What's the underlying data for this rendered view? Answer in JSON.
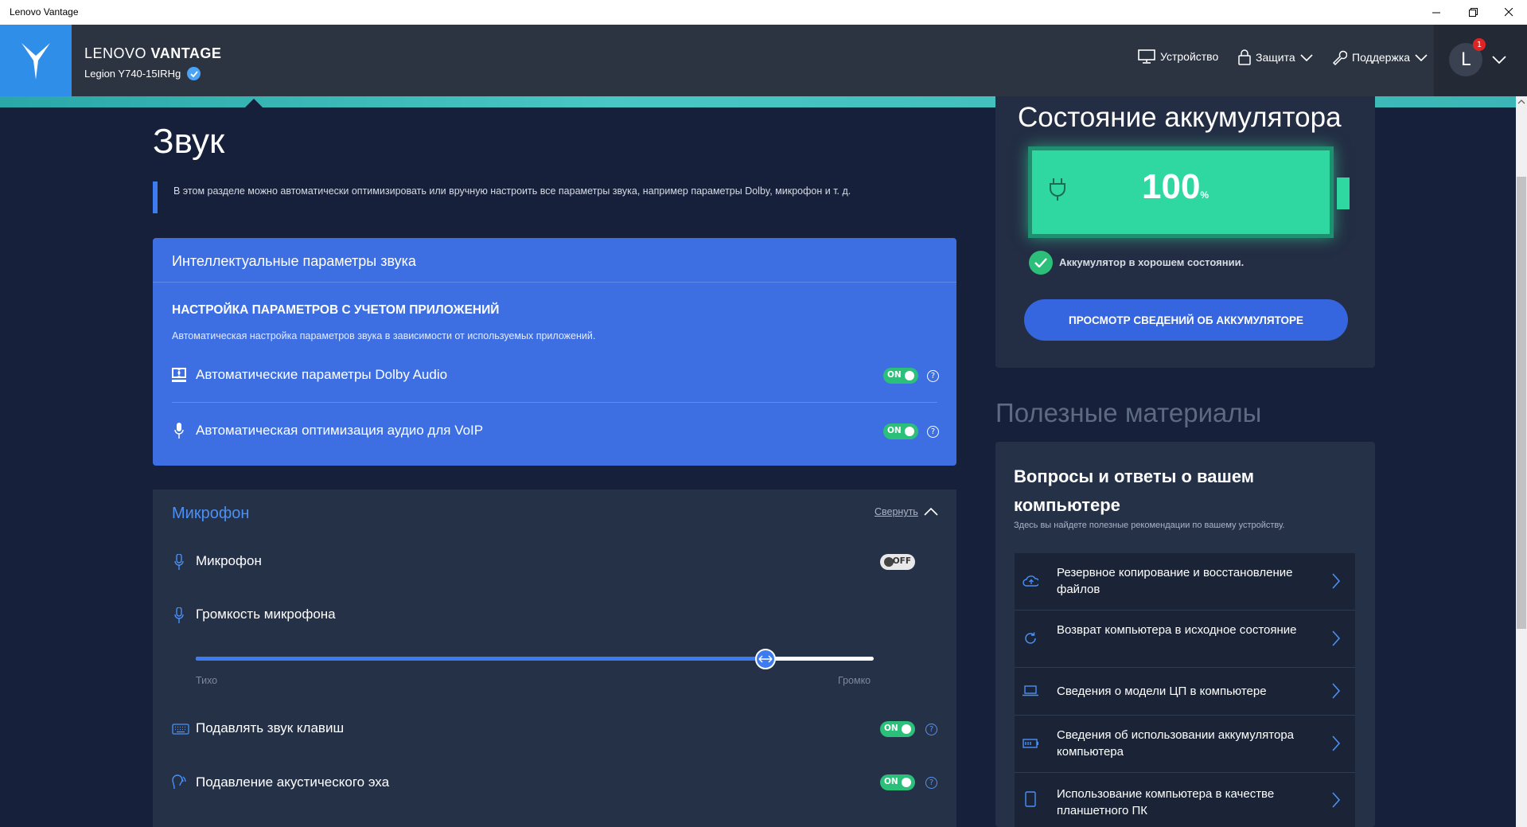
{
  "window": {
    "title": "Lenovo Vantage"
  },
  "header": {
    "brand_light": "LENOVO ",
    "brand_bold": "VANTAGE",
    "model": "Legion Y740-15IRHg",
    "nav": {
      "device": "Устройство",
      "security": "Защита",
      "support": "Поддержка"
    },
    "user_initial": "L",
    "notification_count": "1"
  },
  "page": {
    "title": "Звук",
    "description": "В этом разделе можно автоматически оптимизировать или вручную настроить все параметры звука, например параметры Dolby, микрофон и т. д."
  },
  "smart_audio": {
    "title": "Интеллектуальные параметры звука",
    "subtitle": "НАСТРОЙКА ПАРАМЕТРОВ С УЧЕТОМ ПРИЛОЖЕНИЙ",
    "description": "Автоматическая настройка параметров звука в зависимости от используемых приложений.",
    "rows": [
      {
        "label": "Автоматические параметры Dolby Audio",
        "state": "ON",
        "icon": "dolby-icon"
      },
      {
        "label": "Автоматическая оптимизация аудио для VoIP",
        "state": "ON",
        "icon": "voip-microphone-icon"
      }
    ]
  },
  "microphone": {
    "title": "Микрофон",
    "collapse_label": "Свернуть",
    "mic_label": "Микрофон",
    "mic_state": "OFF",
    "volume_label": "Громкость микрофона",
    "volume_low": "Тихо",
    "volume_high": "Громко",
    "volume_level": 0.84,
    "keyboard_noise_label": "Подавлять звук клавиш",
    "keyboard_noise_state": "ON",
    "echo_label": "Подавление акустического эха",
    "echo_state": "ON"
  },
  "battery": {
    "title": "Состояние аккумулятора",
    "percent": "100",
    "percent_unit": "%",
    "status": "Аккумулятор в хорошем состоянии.",
    "button": "ПРОСМОТР СВЕДЕНИЙ ОБ АККУМУЛЯТОРЕ"
  },
  "useful": {
    "title": "Полезные материалы"
  },
  "faq": {
    "title": "Вопросы и ответы о вашем компьютере",
    "subtitle": "Здесь вы найдете полезные рекомендации по вашему устройству.",
    "items": [
      {
        "label": "Резервное копирование и восстановление файлов",
        "icon": "cloud-backup-icon"
      },
      {
        "label": "Возврат компьютера в исходное состояние",
        "icon": "refresh-icon"
      },
      {
        "label": "Сведения о модели ЦП в компьютере",
        "icon": "laptop-icon"
      },
      {
        "label": "Сведения об использовании аккумулятора компьютера",
        "icon": "battery-icon"
      },
      {
        "label": "Использование компьютера в качестве планшетного ПК",
        "icon": "tablet-icon"
      }
    ]
  },
  "colors": {
    "accent": "#3c7cf0",
    "toggle_on": "#2bbf7a",
    "battery_green": "#2fd8a0"
  }
}
